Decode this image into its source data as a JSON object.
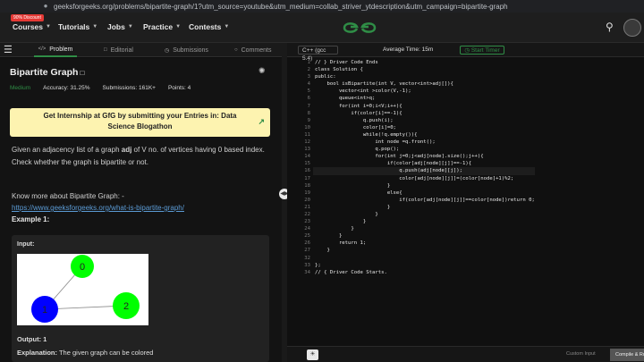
{
  "browser": {
    "url": "geeksforgeeks.org/problems/bipartite-graph/1?utm_source=youtube&utm_medium=collab_striver_ytdescription&utm_campaign=bipartite-graph"
  },
  "nav": {
    "badge": "90% Discount",
    "items": [
      {
        "label": "Courses"
      },
      {
        "label": "Tutorials"
      },
      {
        "label": "Jobs"
      },
      {
        "label": "Practice"
      },
      {
        "label": "Contests"
      }
    ]
  },
  "tabs": [
    {
      "label": "Problem"
    },
    {
      "label": "Editorial"
    },
    {
      "label": "Submissions"
    },
    {
      "label": "Comments"
    }
  ],
  "problem": {
    "title": "Bipartite Graph",
    "difficulty": "Medium",
    "accuracy": "Accuracy: 31.25%",
    "submissions": "Submissions: 161K+",
    "points": "Points: 4",
    "banner": "Get Internship at GfG by submitting your Entries in: Data Science Blogathon",
    "desc_pre": "Given an adjacency list of a graph ",
    "desc_bold": "adj",
    "desc_post": " of V no. of vertices having 0 based index. Check whether the graph is bipartite or not.",
    "know_more": "Know more about Bipartite Graph: -",
    "link": "https://www.geeksforgeeks.org/what-is-bipartite-graph/",
    "example_heading": "Example 1:",
    "input_label": "Input:",
    "graph": {
      "nodes": [
        {
          "label": "0",
          "color": "#00ff00"
        },
        {
          "label": "1",
          "color": "#0000ff"
        },
        {
          "label": "2",
          "color": "#00ff00"
        }
      ]
    },
    "output": "Output:  1",
    "explanation_label": "Explanation:",
    "explanation_text": "The  given  graph  can  be  colored"
  },
  "editor": {
    "language": "C++ (gcc 5.4)",
    "avg_time": "Average Time: 15m",
    "timer_label": "Start Timer",
    "lines": [
      {
        "num": "1",
        "text": "// } Driver Code Ends",
        "fold": true
      },
      {
        "num": "2",
        "text": "class Solution {"
      },
      {
        "num": "3",
        "text": "public:"
      },
      {
        "num": "4",
        "text": "    bool isBipartite(int V, vector<int>adj[]){"
      },
      {
        "num": "5",
        "text": "        vector<int >color(V,-1);"
      },
      {
        "num": "6",
        "text": "        queue<int>q;"
      },
      {
        "num": "7",
        "text": "        for(int i=0;i<V;i++){"
      },
      {
        "num": "8",
        "text": "            if(color[i]==-1){"
      },
      {
        "num": "9",
        "text": "                q.push(i);"
      },
      {
        "num": "10",
        "text": "                color[i]=0;"
      },
      {
        "num": "11",
        "text": "                while(!q.empty()){"
      },
      {
        "num": "12",
        "text": "                    int node =q.front();"
      },
      {
        "num": "13",
        "text": "                    q.pop();"
      },
      {
        "num": "14",
        "text": "                    for(int j=0;j<adj[node].size();j++){"
      },
      {
        "num": "15",
        "text": "                        if(color[adj[node][j]]==-1){"
      },
      {
        "num": "16",
        "text": "                            q.push(adj[node][j]);",
        "hl": true
      },
      {
        "num": "17",
        "text": "                            color[adj[node][j]]=(color[node]+1)%2;"
      },
      {
        "num": "18",
        "text": "                        }"
      },
      {
        "num": "19",
        "text": "                        else{"
      },
      {
        "num": "20",
        "text": "                            if(color[adj[node][j]]==color[node])return 0;"
      },
      {
        "num": "21",
        "text": "                        }"
      },
      {
        "num": "22",
        "text": "                    }"
      },
      {
        "num": "23",
        "text": "                }"
      },
      {
        "num": "24",
        "text": "            }"
      },
      {
        "num": "25",
        "text": "        }"
      },
      {
        "num": "26",
        "text": "        return 1;"
      },
      {
        "num": "27",
        "text": "    }"
      },
      {
        "num": "32",
        "text": ""
      },
      {
        "num": "33",
        "text": "};"
      },
      {
        "num": "34",
        "text": "// { Driver Code Starts.",
        "fold": true
      }
    ],
    "custom_input": "Custom Input",
    "compile_run": "Compile & Run"
  },
  "colors": {
    "accent": "#2f8d46",
    "banner": "#fdf3b0"
  }
}
